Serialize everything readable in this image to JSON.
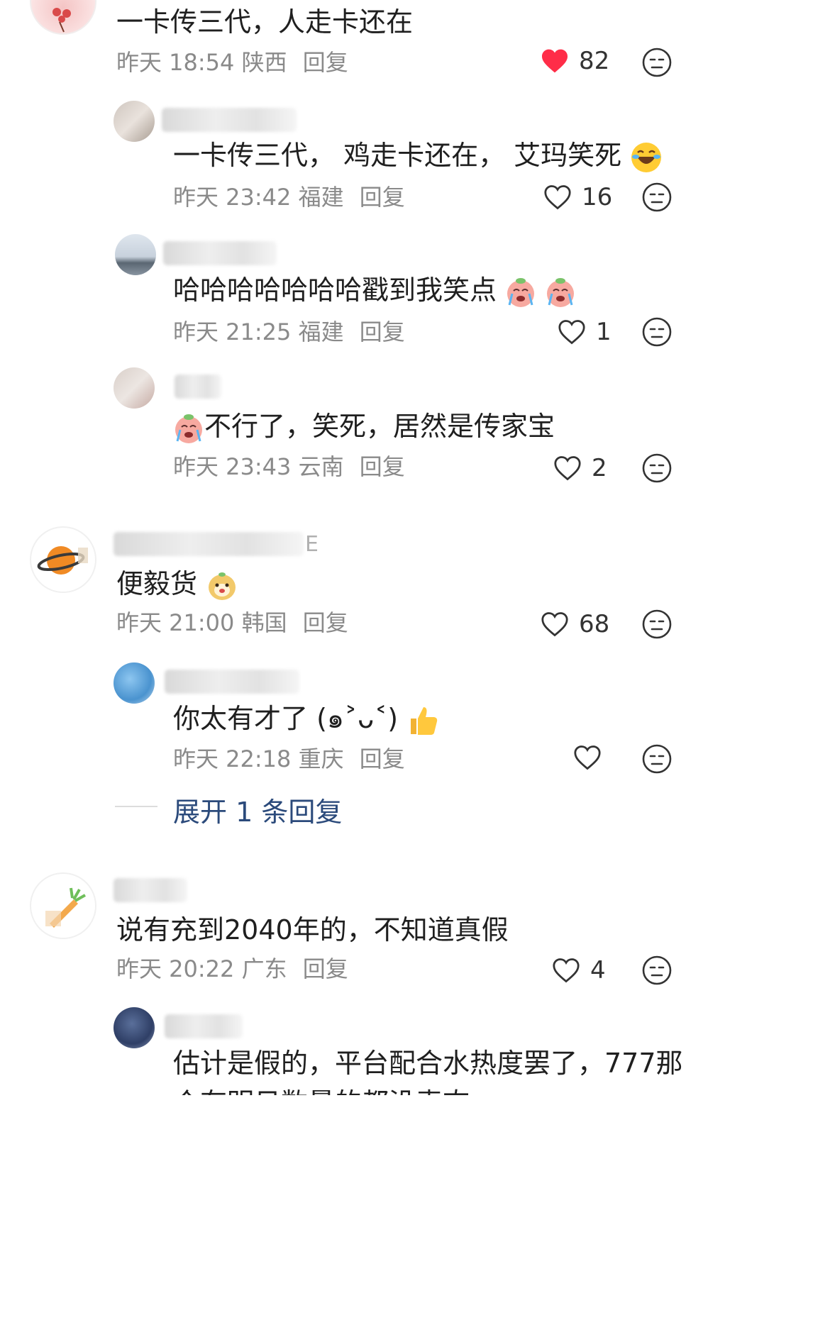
{
  "comments": [
    {
      "text": "一卡传三代，人走卡还在",
      "time": "昨天 18:54",
      "location": "陕西",
      "reply": "回复",
      "likes": "82",
      "liked": true
    },
    {
      "text": "一卡传三代， 鸡走卡还在， 艾玛笑死",
      "time": "昨天 23:42",
      "location": "福建",
      "reply": "回复",
      "likes": "16"
    },
    {
      "text": "哈哈哈哈哈哈哈戳到我笑点",
      "time": "昨天 21:25",
      "location": "福建",
      "reply": "回复",
      "likes": "1"
    },
    {
      "text": "不行了，笑死，居然是传家宝",
      "time": "昨天 23:43",
      "location": "云南",
      "reply": "回复",
      "likes": "2"
    },
    {
      "name_suffix": "E",
      "text": "便毅货",
      "time": "昨天 21:00",
      "location": "韩国",
      "reply": "回复",
      "likes": "68"
    },
    {
      "text": "你太有才了 (๑˃ᴗ˂)",
      "time": "昨天 22:18",
      "location": "重庆",
      "reply": "回复",
      "likes": ""
    },
    {
      "text": "说有充到2040年的，不知道真假",
      "time": "昨天 20:22",
      "location": "广东",
      "reply": "回复",
      "likes": "4"
    },
    {
      "text": "估计是假的，平台配合水热度罢了，777那",
      "text_cut": "个有明日数量的都没表态"
    }
  ],
  "expand_replies": "展开 1 条回复",
  "colors": {
    "liked": "#ff2d48",
    "meta": "#8a8a8a",
    "expand": "#2b4a7b"
  },
  "icons": [
    "heart-icon",
    "dislike-face-icon",
    "laugh-emoji",
    "crying-emoji",
    "thumbs-up-emoji"
  ]
}
